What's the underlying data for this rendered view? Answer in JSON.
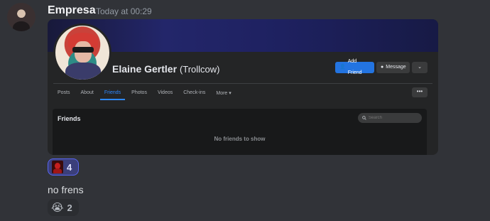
{
  "message": {
    "username": "Empresa",
    "timestamp": "Today at 00:29",
    "text": "no frens"
  },
  "embed": {
    "profile_name": "Elaine Gertler",
    "profile_alt_name": "(Trollcow)",
    "buttons": {
      "add_friend": "Add Friend",
      "message": "Message",
      "more": "⌄"
    },
    "tabs": [
      "Posts",
      "About",
      "Friends",
      "Photos",
      "Videos",
      "Check-ins",
      "More ▾"
    ],
    "active_tab": "Friends",
    "tab_more_button": "•••",
    "friends_section": {
      "title": "Friends",
      "search_placeholder": "Search",
      "empty_text": "No friends to show"
    }
  },
  "reactions": [
    {
      "emoji": "red-face-emoji",
      "count": "4",
      "selected": true
    },
    {
      "emoji": "😭",
      "count": "2",
      "selected": false
    }
  ],
  "colors": {
    "background": "#313338",
    "fb_blue": "#2374e1",
    "tab_active": "#2d88ff",
    "reaction_selected": "#5865f2"
  }
}
